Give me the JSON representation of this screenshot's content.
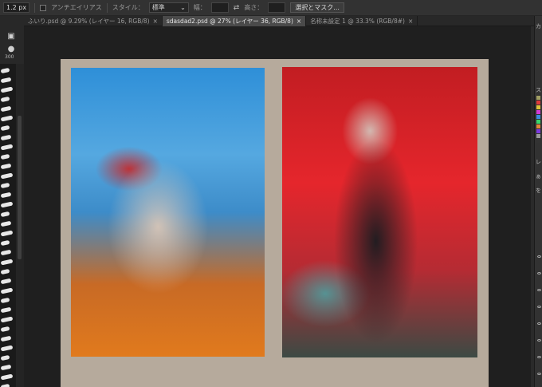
{
  "options_bar": {
    "stroke_width": "1.2 px",
    "antialias_label": "アンチエイリアス",
    "style_label": "スタイル：",
    "style_value": "標準",
    "width_label": "幅：",
    "height_label": "高さ：",
    "select_mask_button": "選択とマスク..."
  },
  "tabs": [
    {
      "label": "ふいり.psd @ 9.29% (レイヤー 16, RGB/8)",
      "close": "×"
    },
    {
      "label": "sdasdad2.psd @ 27% (レイヤー 36, RGB/8)",
      "close": "×"
    },
    {
      "label": "名称未設定 1 @ 33.3% (RGB/8#)",
      "close": "×"
    }
  ],
  "toolbar": {
    "size_value": "300"
  },
  "right_panel": {
    "labels": [
      "カ",
      "ス",
      "レ",
      "ぁ",
      "を"
    ]
  },
  "colors": {
    "panel_bg": "#323232",
    "canvas_bg": "#1f1f1f",
    "document_bg": "#b6aa9c",
    "swatches": [
      "#a19e64",
      "#e03a3a",
      "#e0c23a",
      "#d23ad6",
      "#3a8be0",
      "#3ad66a",
      "#e0863a",
      "#7c3ae0",
      "#999999",
      "#333333"
    ]
  }
}
